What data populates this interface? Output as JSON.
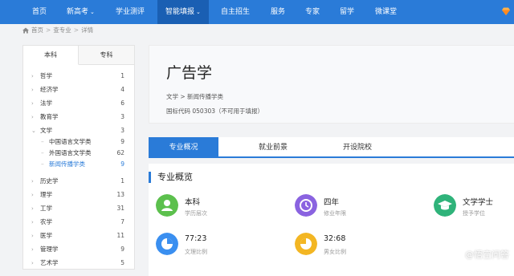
{
  "nav": {
    "items": [
      {
        "label": "首页"
      },
      {
        "label": "新高考"
      },
      {
        "label": "学业测评"
      },
      {
        "label": "智能填报"
      },
      {
        "label": "自主招生"
      },
      {
        "label": "服务"
      },
      {
        "label": "专家"
      },
      {
        "label": "留学"
      },
      {
        "label": "微课堂"
      }
    ],
    "caret": "⌄",
    "active_index": 3,
    "color_bar": "#2a7bd8",
    "color_active": "#1a5fb3"
  },
  "breadcrumb": {
    "items": [
      "首页",
      "查专业",
      "详情"
    ],
    "separator": ">"
  },
  "sidebar": {
    "tabs": [
      {
        "label": "本科"
      },
      {
        "label": "专科"
      }
    ],
    "categories": [
      {
        "name": "哲学",
        "count": "1"
      },
      {
        "name": "经济学",
        "count": "4"
      },
      {
        "name": "法学",
        "count": "6"
      },
      {
        "name": "教育学",
        "count": "3"
      },
      {
        "name": "文学",
        "count": "3"
      },
      {
        "name": "中国语言文学类",
        "count": "9"
      },
      {
        "name": "外国语言文学类",
        "count": "62"
      },
      {
        "name": "新闻传播学类",
        "count": "9"
      },
      {
        "name": "历史学",
        "count": "1"
      },
      {
        "name": "理学",
        "count": "13"
      },
      {
        "name": "工学",
        "count": "31"
      },
      {
        "name": "农学",
        "count": "7"
      },
      {
        "name": "医学",
        "count": "11"
      },
      {
        "name": "管理学",
        "count": "9"
      },
      {
        "name": "艺术学",
        "count": "5"
      }
    ]
  },
  "major": {
    "title": "广告学",
    "path": "文学 > 新闻传播学类",
    "code": "国标代码 050303（不可用于填报）"
  },
  "content_tabs": [
    {
      "label": "专业概况"
    },
    {
      "label": "就业前景"
    },
    {
      "label": "开设院校"
    }
  ],
  "overview": {
    "title": "专业概览",
    "stats": [
      {
        "value": "本科",
        "label": "学历层次",
        "icon": "graduate-icon",
        "color": "#5cc04d"
      },
      {
        "value": "四年",
        "label": "修业年限",
        "icon": "clock-icon",
        "color": "#8a63e0"
      },
      {
        "value": "文学学士",
        "label": "授予学位",
        "icon": "cap-icon",
        "color": "#2fb37a"
      },
      {
        "value": "77:23",
        "label": "文理比例",
        "icon": "pie-chart-icon",
        "color": "#3a8ff0"
      },
      {
        "value": "32:68",
        "label": "男女比例",
        "icon": "gender-pie-icon",
        "color": "#f3b623"
      }
    ]
  },
  "watermark": {
    "text": "@悟空问答"
  }
}
